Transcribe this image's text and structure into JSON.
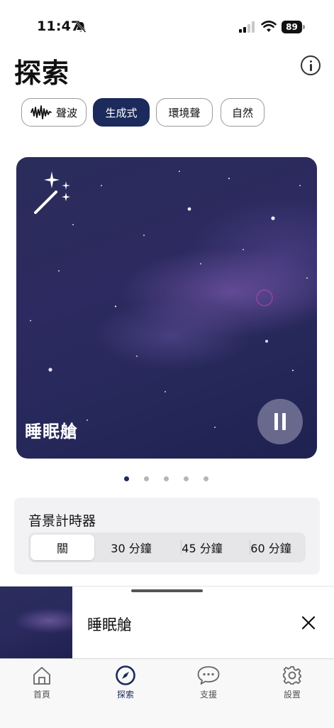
{
  "status_bar": {
    "time": "11:47",
    "battery": "89"
  },
  "header": {
    "title": "探索"
  },
  "chips": [
    {
      "label": "聲波",
      "icon": "waveform-icon"
    },
    {
      "label": "生成式"
    },
    {
      "label": "環境聲"
    },
    {
      "label": "自然"
    }
  ],
  "card": {
    "title": "睡眠艙",
    "icon": "magic-wand-icon",
    "state": "playing"
  },
  "pager": {
    "count": 5,
    "active_index": 0
  },
  "timer": {
    "title": "音景計時器",
    "options": [
      "關",
      "30 分鐘",
      "45 分鐘",
      "60 分鐘"
    ],
    "selected": "關"
  },
  "mini_player": {
    "title": "睡眠艙"
  },
  "tab_bar": [
    {
      "label": "首頁",
      "icon": "home-icon"
    },
    {
      "label": "探索",
      "icon": "compass-icon"
    },
    {
      "label": "支援",
      "icon": "chat-bubble-icon"
    },
    {
      "label": "設置",
      "icon": "gear-icon"
    }
  ],
  "colors": {
    "accent": "#1c2a5c",
    "timer_panel": "#f2f2f4",
    "card_sky": "#2a2c5a"
  }
}
